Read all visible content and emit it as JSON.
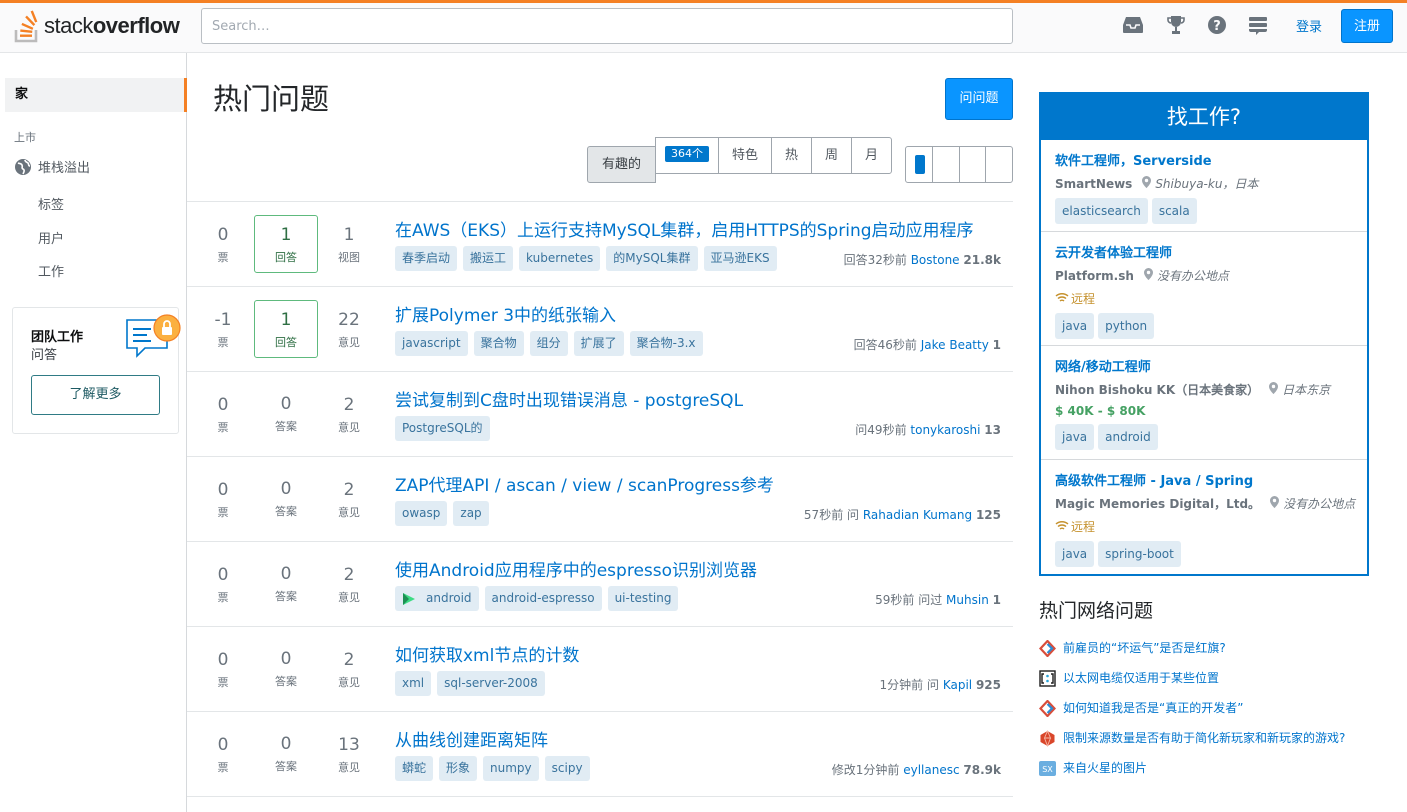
{
  "header": {
    "logo_plain": "stack",
    "logo_bold": "overflow",
    "search_placeholder": "Search…",
    "login_label": "登录",
    "signup_label": "注册",
    "icons": [
      "inbox-icon",
      "trophy-icon",
      "help-icon",
      "site-switcher-icon"
    ]
  },
  "leftnav": {
    "home": "家",
    "section": "上市",
    "stackoverflow": "堆栈溢出",
    "items": [
      "标签",
      "用户",
      "工作"
    ],
    "teams": {
      "title": "团队工作",
      "subtitle": "问答",
      "button": "了解更多"
    }
  },
  "main": {
    "title": "热门问题",
    "ask_button": "问问题",
    "filters": {
      "interesting": "有趣的",
      "featured_count": "364个",
      "featured": "特色",
      "hot": "热",
      "week": "周",
      "month": "月"
    },
    "questions": [
      {
        "votes": "0",
        "votes_label": "票",
        "answers": "1",
        "answers_label": "回答",
        "answered": true,
        "views": "1",
        "views_label": "视图",
        "title": "在AWS（EKS）上运行支持MySQL集群，启用HTTPS的Spring启动应用程序",
        "tags": [
          "春季启动",
          "搬运工",
          "kubernetes",
          "的MySQL集群",
          "亚马逊EKS"
        ],
        "meta_action": "回答32秒前",
        "user": "Bostone",
        "rep": "21.8k"
      },
      {
        "votes": "-1",
        "votes_label": "票",
        "answers": "1",
        "answers_label": "回答",
        "answered": true,
        "views": "22",
        "views_label": "意见",
        "title": "扩展Polymer 3中的纸张输入",
        "tags": [
          "javascript",
          "聚合物",
          "组分",
          "扩展了",
          "聚合物-3.x"
        ],
        "meta_action": "回答46秒前",
        "user": "Jake Beatty",
        "rep": "1"
      },
      {
        "votes": "0",
        "votes_label": "票",
        "answers": "0",
        "answers_label": "答案",
        "answered": false,
        "views": "2",
        "views_label": "意见",
        "title": "尝试复制到C盘时出现错误消息 - postgreSQL",
        "tags": [
          "PostgreSQL的"
        ],
        "meta_action": "问49秒前",
        "user": "tonykaroshi",
        "rep": "13"
      },
      {
        "votes": "0",
        "votes_label": "票",
        "answers": "0",
        "answers_label": "答案",
        "answered": false,
        "views": "2",
        "views_label": "意见",
        "title": "ZAP代理API / ascan / view / scanProgress参考",
        "tags": [
          "owasp",
          "zap"
        ],
        "meta_action": "57秒前 问",
        "user": "Rahadian Kumang",
        "rep": "125"
      },
      {
        "votes": "0",
        "votes_label": "票",
        "answers": "0",
        "answers_label": "答案",
        "answered": false,
        "views": "2",
        "views_label": "意见",
        "title": "使用Android应用程序中的espresso识别浏览器",
        "tags": [
          "android",
          "android-espresso",
          "ui-testing"
        ],
        "meta_action": "59秒前 问过",
        "user": "Muhsin",
        "rep": "1"
      },
      {
        "votes": "0",
        "votes_label": "票",
        "answers": "0",
        "answers_label": "答案",
        "answered": false,
        "views": "2",
        "views_label": "意见",
        "title": "如何获取xml节点的计数",
        "tags": [
          "xml",
          "sql-server-2008"
        ],
        "meta_action": "1分钟前 问",
        "user": "Kapil",
        "rep": "925"
      },
      {
        "votes": "0",
        "votes_label": "票",
        "answers": "0",
        "answers_label": "答案",
        "answered": false,
        "views": "13",
        "views_label": "意见",
        "title": "从曲线创建距离矩阵",
        "tags": [
          "蟒蛇",
          "形象",
          "numpy",
          "scipy"
        ],
        "meta_action": "修改1分钟前",
        "user": "eyllanesc",
        "rep": "78.9k"
      }
    ]
  },
  "jobs": {
    "heading": "找工作?",
    "remote_label": "远程",
    "items": [
      {
        "title": "软件工程师，Serverside",
        "company": "SmartNews",
        "location": "Shibuya-ku，日本",
        "remote": false,
        "salary": "",
        "tags": [
          "elasticsearch",
          "scala"
        ]
      },
      {
        "title": "云开发者体验工程师",
        "company": "Platform.sh",
        "location": "没有办公地点",
        "remote": true,
        "salary": "",
        "tags": [
          "java",
          "python"
        ]
      },
      {
        "title": "网络/移动工程师",
        "company": "Nihon Bishoku KK（日本美食家）",
        "location": "日本东京",
        "remote": false,
        "salary": "$ 40K - $ 80K",
        "tags": [
          "java",
          "android"
        ]
      },
      {
        "title": "高级软件工程师 - Java / Spring",
        "company": "Magic Memories Digital，Ltd。",
        "location": "没有办公地点",
        "remote": true,
        "salary": "",
        "tags": [
          "java",
          "spring-boot"
        ]
      }
    ]
  },
  "hot_network": {
    "title": "热门网络问题",
    "items": [
      {
        "text": "前雇员的“坏运气”是否是红旗?",
        "icon": "workplace-icon"
      },
      {
        "text": "以太网电缆仅适用于某些位置",
        "icon": "superuser-icon"
      },
      {
        "text": "如何知道我是否是“真正的开发者”",
        "icon": "workplace-icon"
      },
      {
        "text": "限制来源数量是否有助于简化新玩家和新玩家的游戏?",
        "icon": "rpg-icon"
      },
      {
        "text": "来自火星的图片",
        "icon": "space-icon"
      }
    ]
  },
  "colors": {
    "accent_orange": "#f48024",
    "link_blue": "#0077cc",
    "button_blue": "#0a95ff",
    "tag_bg": "#e1ecf4",
    "tag_text": "#39739d",
    "answered_green": "#5eba7d"
  }
}
